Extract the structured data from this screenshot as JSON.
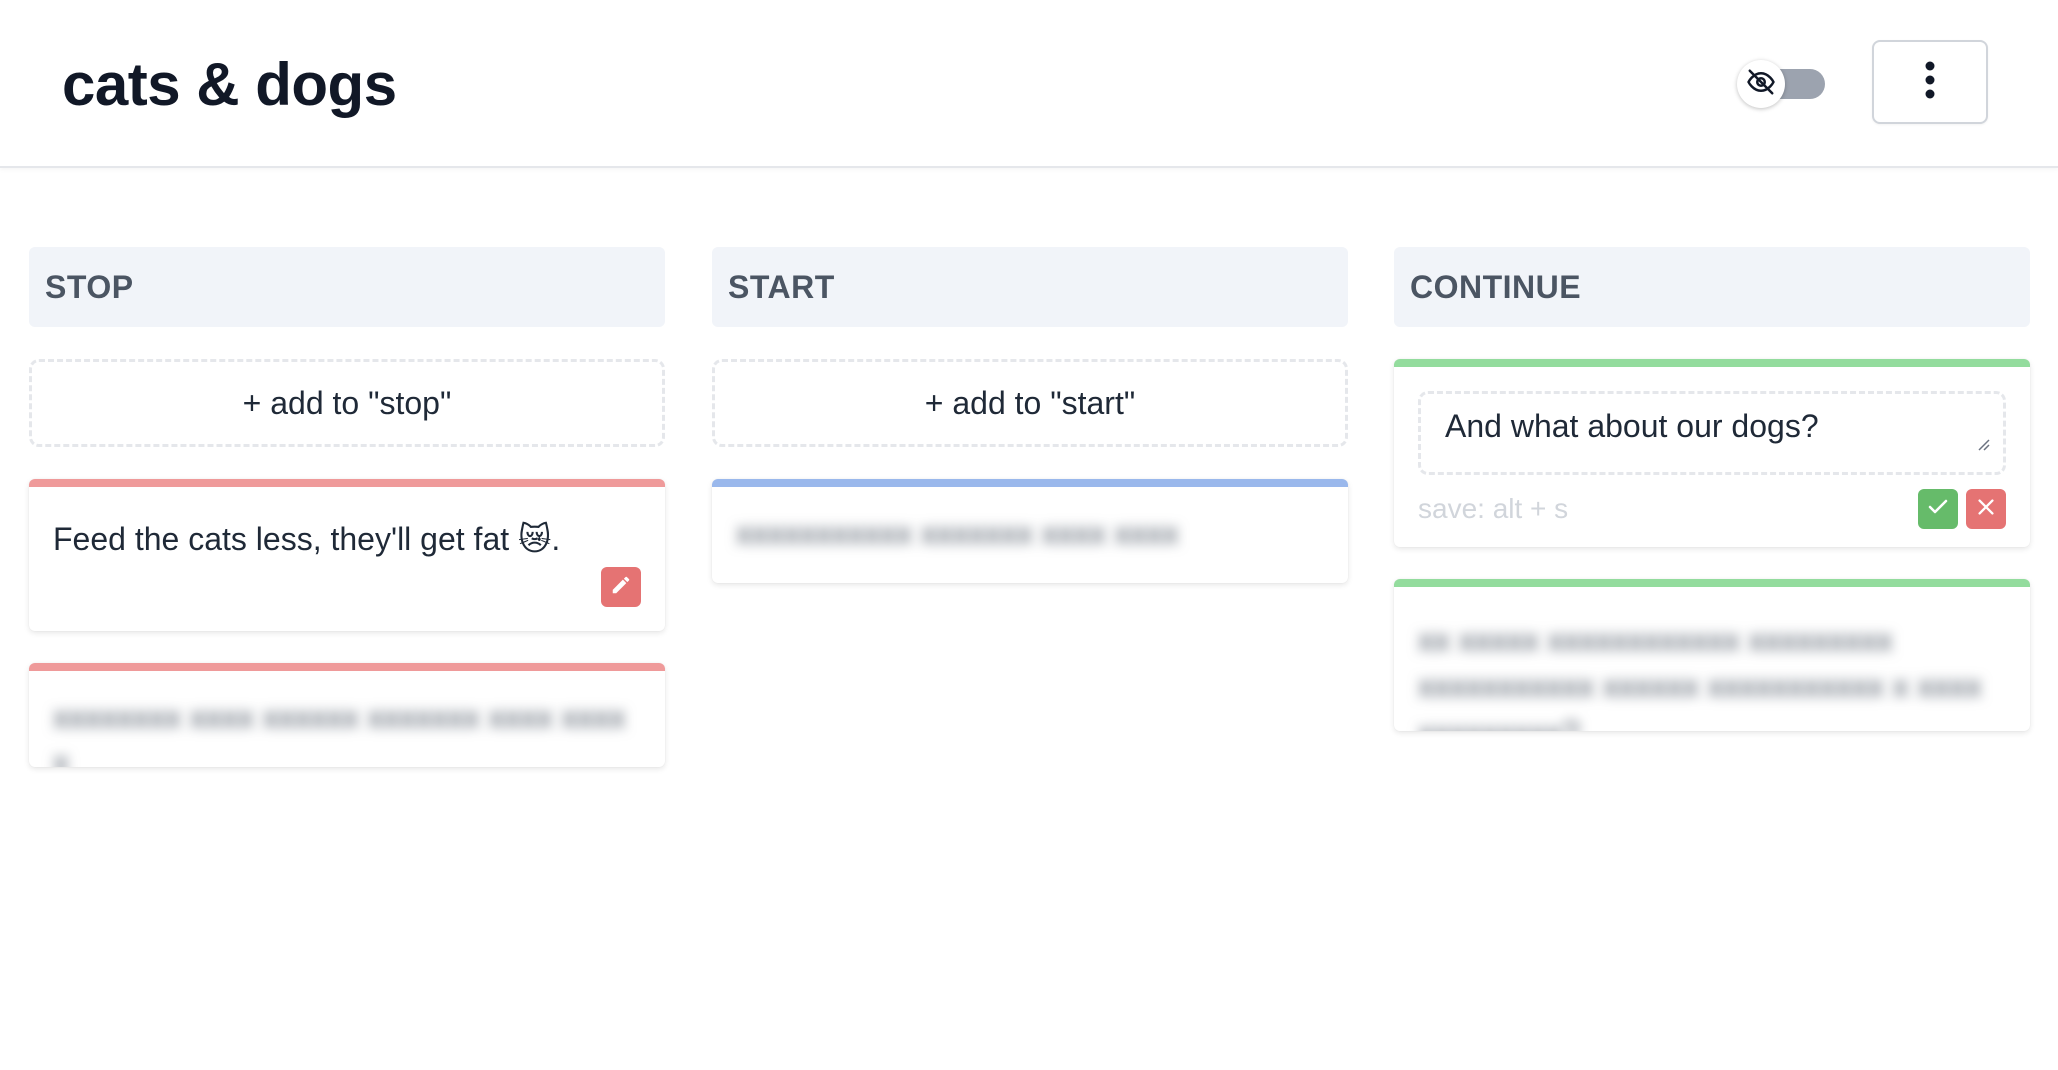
{
  "board": {
    "title": "cats & dogs"
  },
  "header": {
    "toggle_icon": "eye-off-icon",
    "menu_icon": "vertical-dots-icon"
  },
  "columns": [
    {
      "title": "STOP",
      "add_label": "+ add to \"stop\"",
      "color": "#ef9a9a",
      "cards": [
        {
          "text": "Feed the cats less, they'll get fat 😿.",
          "blurred": false
        },
        {
          "text": "xxxxxxxx xxxx xxxxxx xxxxxxx xxxx xxxx x",
          "blurred": true
        }
      ]
    },
    {
      "title": "START",
      "add_label": "+ add to \"start\"",
      "color": "#9ab8ec",
      "cards": [
        {
          "text": "xxxxxxxxxxx xxxxxxx xxxx xxxx",
          "blurred": true
        }
      ]
    },
    {
      "title": "CONTINUE",
      "color": "#93dc9d",
      "editing": {
        "value": "And what about our dogs?",
        "save_hint": "save: alt + s"
      },
      "cards": [
        {
          "text": "xx xxxxx xxxxxxxxxxxx xxxxxxxxx xxxxxxxxxxx xxxxxx xxxxxxxxxxx x xxxx xxxxxxxxx?",
          "blurred": true
        }
      ]
    }
  ]
}
